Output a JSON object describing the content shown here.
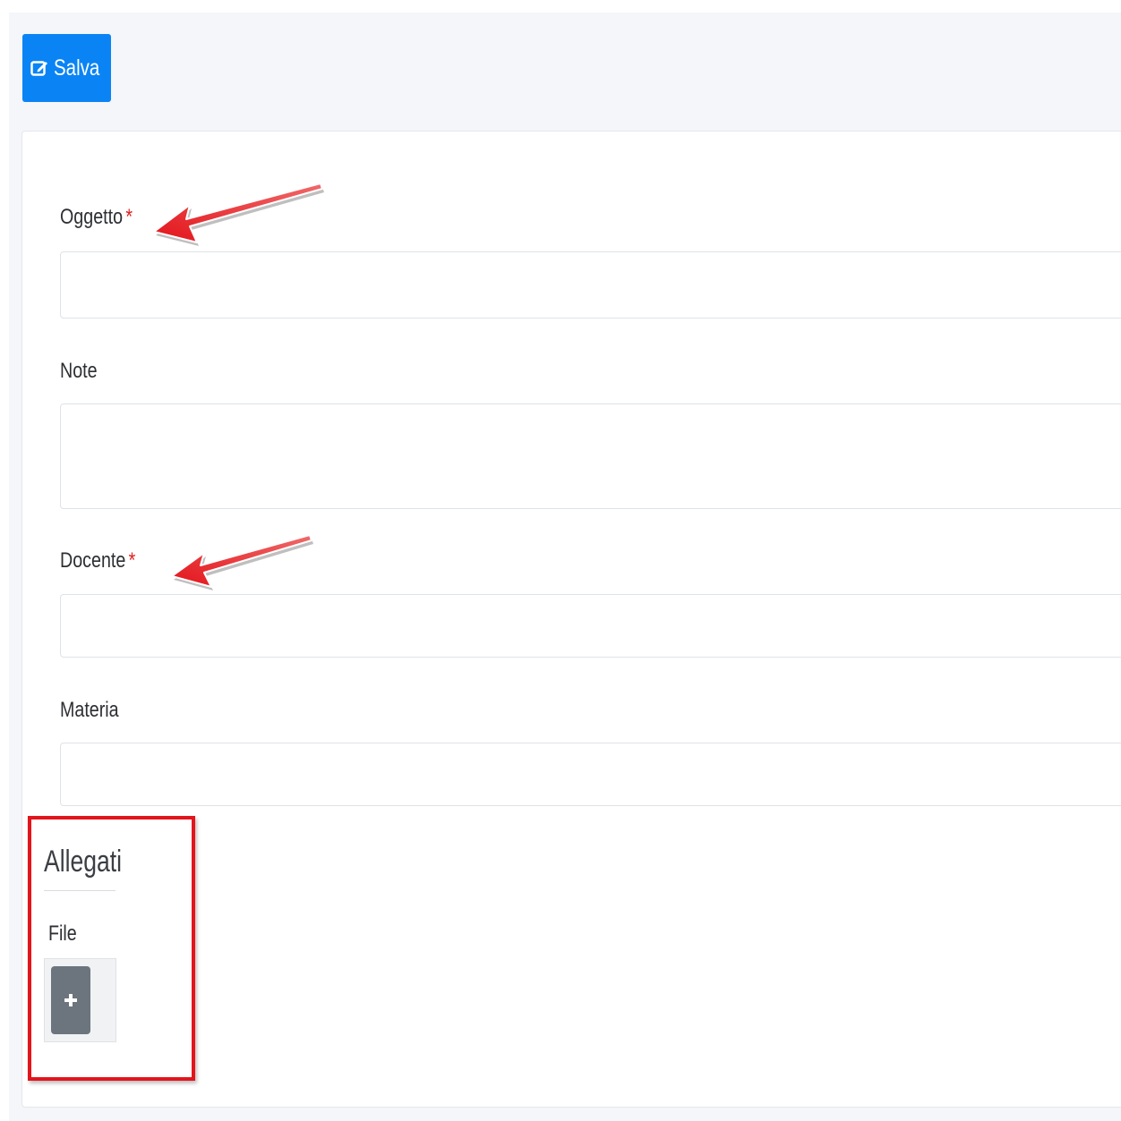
{
  "toolbar": {
    "save_label": "Salva",
    "save_icon": "edit-icon"
  },
  "form": {
    "oggetto": {
      "label": "Oggetto",
      "required_mark": "*",
      "value": ""
    },
    "note": {
      "label": "Note",
      "value": ""
    },
    "docente": {
      "label": "Docente",
      "required_mark": "*",
      "value": ""
    },
    "materia": {
      "label": "Materia",
      "value": ""
    }
  },
  "attachments": {
    "title": "Allegati",
    "file_label": "File",
    "add_icon": "plus-icon"
  },
  "colors": {
    "primary": "#0a84f5",
    "required": "#e02020",
    "annotation": "#e3141b",
    "secondary_button": "#6c757d"
  }
}
